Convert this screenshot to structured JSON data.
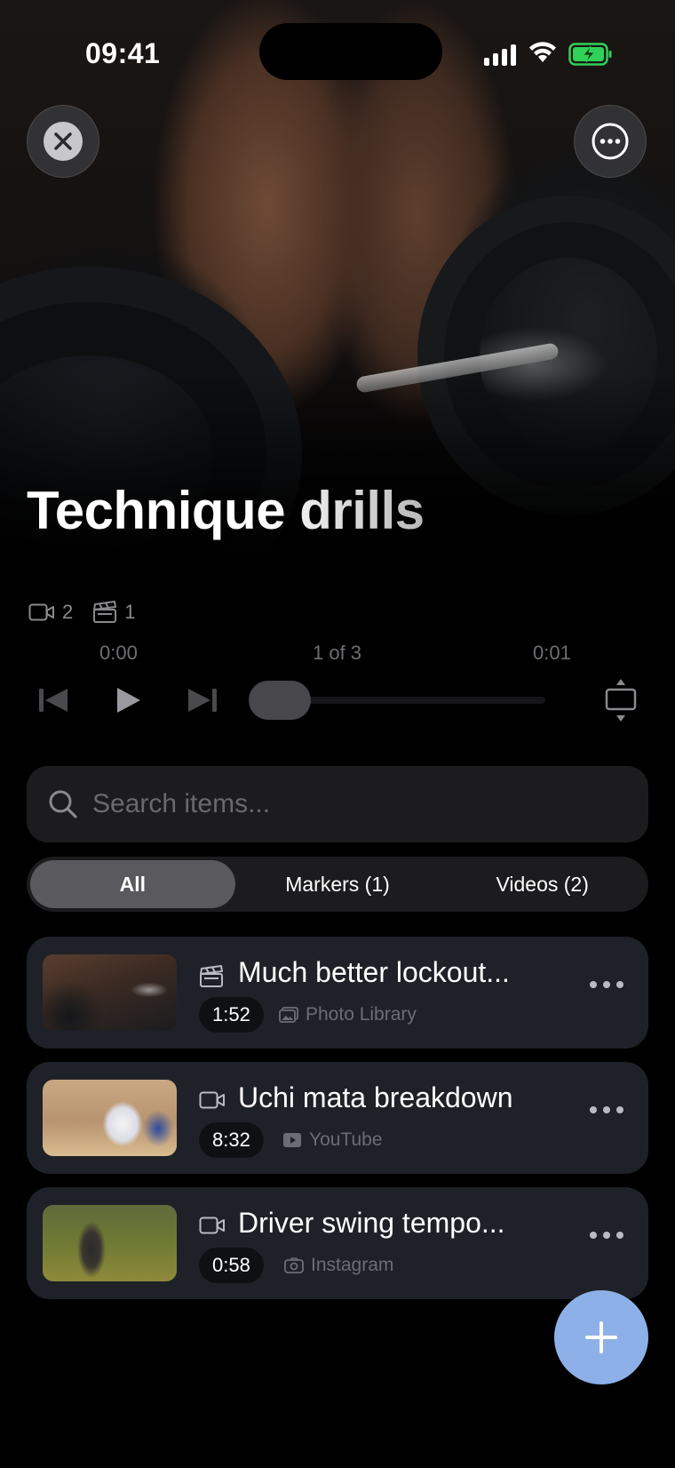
{
  "status_bar": {
    "time": "09:41",
    "battery_color": "#30d158"
  },
  "header": {
    "close_icon": "xmark-circle-icon",
    "more_icon": "ellipsis-circle-icon",
    "title": "Technique drills"
  },
  "counts": {
    "videos": "2",
    "markers": "1"
  },
  "player": {
    "time_current": "0:00",
    "position": "1 of 3",
    "time_total": "0:01",
    "progress": 0.0
  },
  "search": {
    "placeholder": "Search items..."
  },
  "filters": {
    "all": "All",
    "markers": "Markers (1)",
    "videos": "Videos (2)",
    "selected": "All"
  },
  "items": [
    {
      "type_icon": "clapperboard-icon",
      "title": "Much better lockout...",
      "duration": "1:52",
      "source_icon": "photo-icon",
      "source": "Photo Library"
    },
    {
      "type_icon": "video-icon",
      "title": "Uchi mata breakdown",
      "duration": "8:32",
      "source_icon": "youtube-icon",
      "source": "YouTube"
    },
    {
      "type_icon": "video-icon",
      "title": "Driver swing tempo...",
      "duration": "0:58",
      "source_icon": "camera-icon",
      "source": "Instagram"
    }
  ],
  "colors": {
    "fab": "#8eb0e8",
    "card": "#1f2128"
  }
}
